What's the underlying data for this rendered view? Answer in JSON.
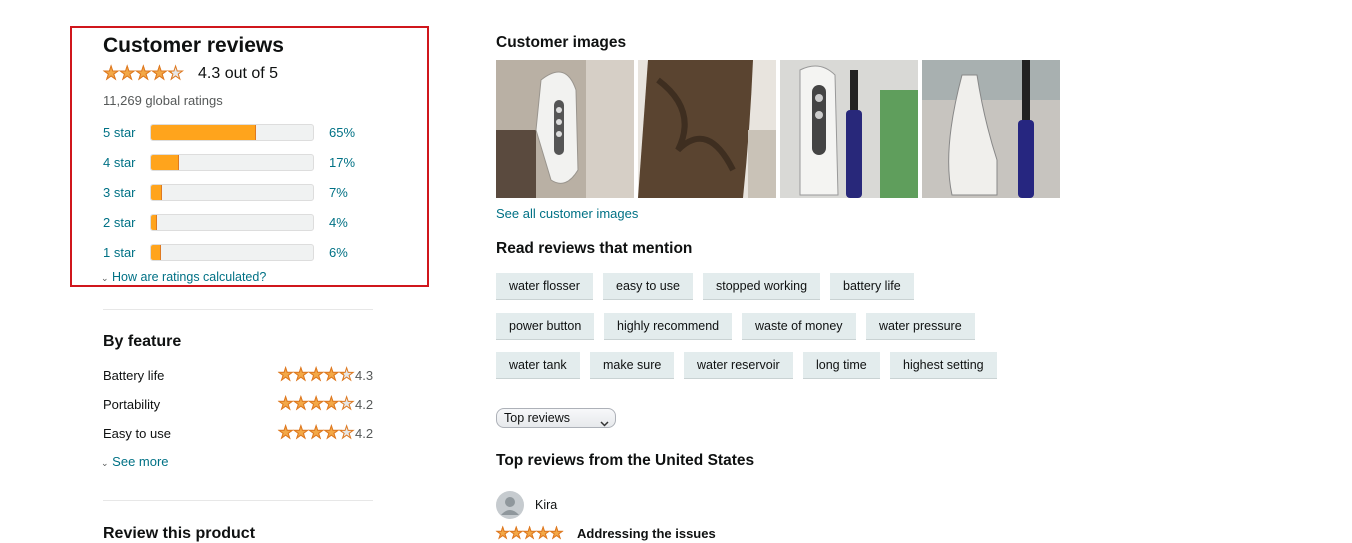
{
  "reviews": {
    "title": "Customer reviews",
    "rating": 4.3,
    "rating_text": "4.3 out of 5",
    "global_ratings": "11,269 global ratings",
    "histogram": [
      {
        "label": "5 star",
        "percent": 65,
        "percent_text": "65%"
      },
      {
        "label": "4 star",
        "percent": 17,
        "percent_text": "17%"
      },
      {
        "label": "3 star",
        "percent": 7,
        "percent_text": "7%"
      },
      {
        "label": "2 star",
        "percent": 4,
        "percent_text": "4%"
      },
      {
        "label": "1 star",
        "percent": 6,
        "percent_text": "6%"
      }
    ],
    "how_calculated": "How are ratings calculated?"
  },
  "by_feature": {
    "title": "By feature",
    "items": [
      {
        "name": "Battery life",
        "rating": 4.3,
        "value": "4.3"
      },
      {
        "name": "Portability",
        "rating": 4.2,
        "value": "4.2"
      },
      {
        "name": "Easy to use",
        "rating": 4.2,
        "value": "4.2"
      }
    ],
    "see_more": "See more"
  },
  "review_product": {
    "title": "Review this product"
  },
  "customer_images": {
    "title": "Customer images",
    "see_all": "See all customer images"
  },
  "mentions": {
    "title": "Read reviews that mention",
    "chips": [
      "water flosser",
      "easy to use",
      "stopped working",
      "battery life",
      "power button",
      "highly recommend",
      "waste of money",
      "water pressure",
      "water tank",
      "make sure",
      "water reservoir",
      "long time",
      "highest setting"
    ]
  },
  "sort": {
    "selected": "Top reviews"
  },
  "top_reviews": {
    "title": "Top reviews from the United States",
    "first": {
      "author": "Kira",
      "rating": 5,
      "headline": "Addressing the issues"
    }
  },
  "colors": {
    "star": "#f3a847",
    "link": "#007185",
    "highlight_box": "#d0161c",
    "bar_fill": "#ffa41c"
  },
  "icons": [
    "star-rating-icon",
    "chevron-down-icon",
    "avatar-icon"
  ]
}
